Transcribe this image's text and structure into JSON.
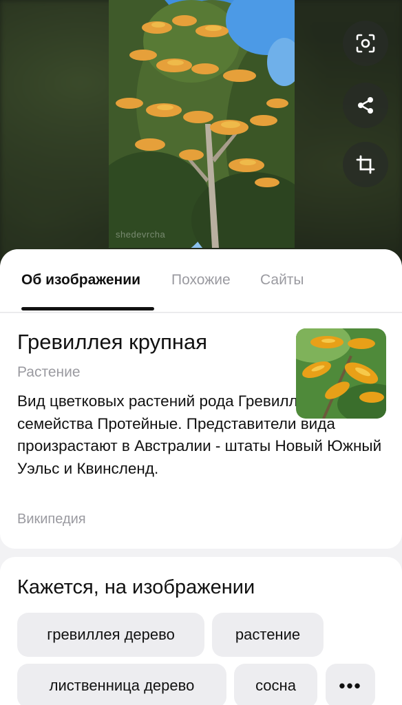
{
  "tabs": [
    {
      "label": "Об изображении",
      "active": true
    },
    {
      "label": "Похожие",
      "active": false
    },
    {
      "label": "Сайты",
      "active": false
    }
  ],
  "photo": {
    "watermark": "shedevrcha"
  },
  "actions": [
    {
      "icon": "lens-scan-icon"
    },
    {
      "icon": "share-icon"
    },
    {
      "icon": "crop-icon"
    }
  ],
  "info": {
    "title": "Гревиллея крупная",
    "category": "Растение",
    "description": "Вид цветковых растений рода Гревиллея семейства Протейные. Представители вида произрастают в Австралии - штаты Новый Южный Уэльс и Квинсленд.",
    "source": "Википедия"
  },
  "tags": {
    "title": "Кажется, на изображении",
    "chips": [
      "гревиллея дерево",
      "растение",
      "лиственница дерево",
      "сосна"
    ],
    "more_label": "•••"
  },
  "colors": {
    "accent": "#111111",
    "muted_text": "#9a9aa0",
    "chip_bg": "#ededf0",
    "flower_orange": "#e8a23a",
    "sky_blue": "#5aa6e8"
  }
}
